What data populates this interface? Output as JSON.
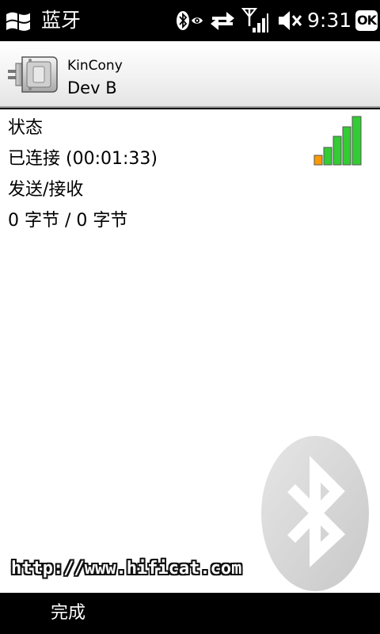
{
  "status_bar": {
    "title": "蓝牙",
    "time": "9:31",
    "ok_label": "OK",
    "icons": [
      "windows-logo-icon",
      "bluetooth-visible-icon",
      "data-sync-icon",
      "signal-strength-icon",
      "volume-muted-icon"
    ]
  },
  "header": {
    "device_name": "KinCony",
    "service_name": "Dev B",
    "icon": "serial-port-icon"
  },
  "details": {
    "status_label": "状态",
    "status_value": "已连接 (00:01:33)",
    "traffic_label": "发送/接收",
    "traffic_value": "0 字节 / 0 字节",
    "signal_icon": "signal-bars-icon",
    "signal_level": "5 of 5"
  },
  "watermark": {
    "url": "http://www.hificat.com",
    "icon": "bluetooth-logo-icon"
  },
  "softkeys": {
    "left_label": "完成"
  },
  "colors": {
    "status_bar_bg": "#000000",
    "content_bg": "#ffffff",
    "signal_green": "#22cc22",
    "signal_orange": "#ff9900"
  }
}
